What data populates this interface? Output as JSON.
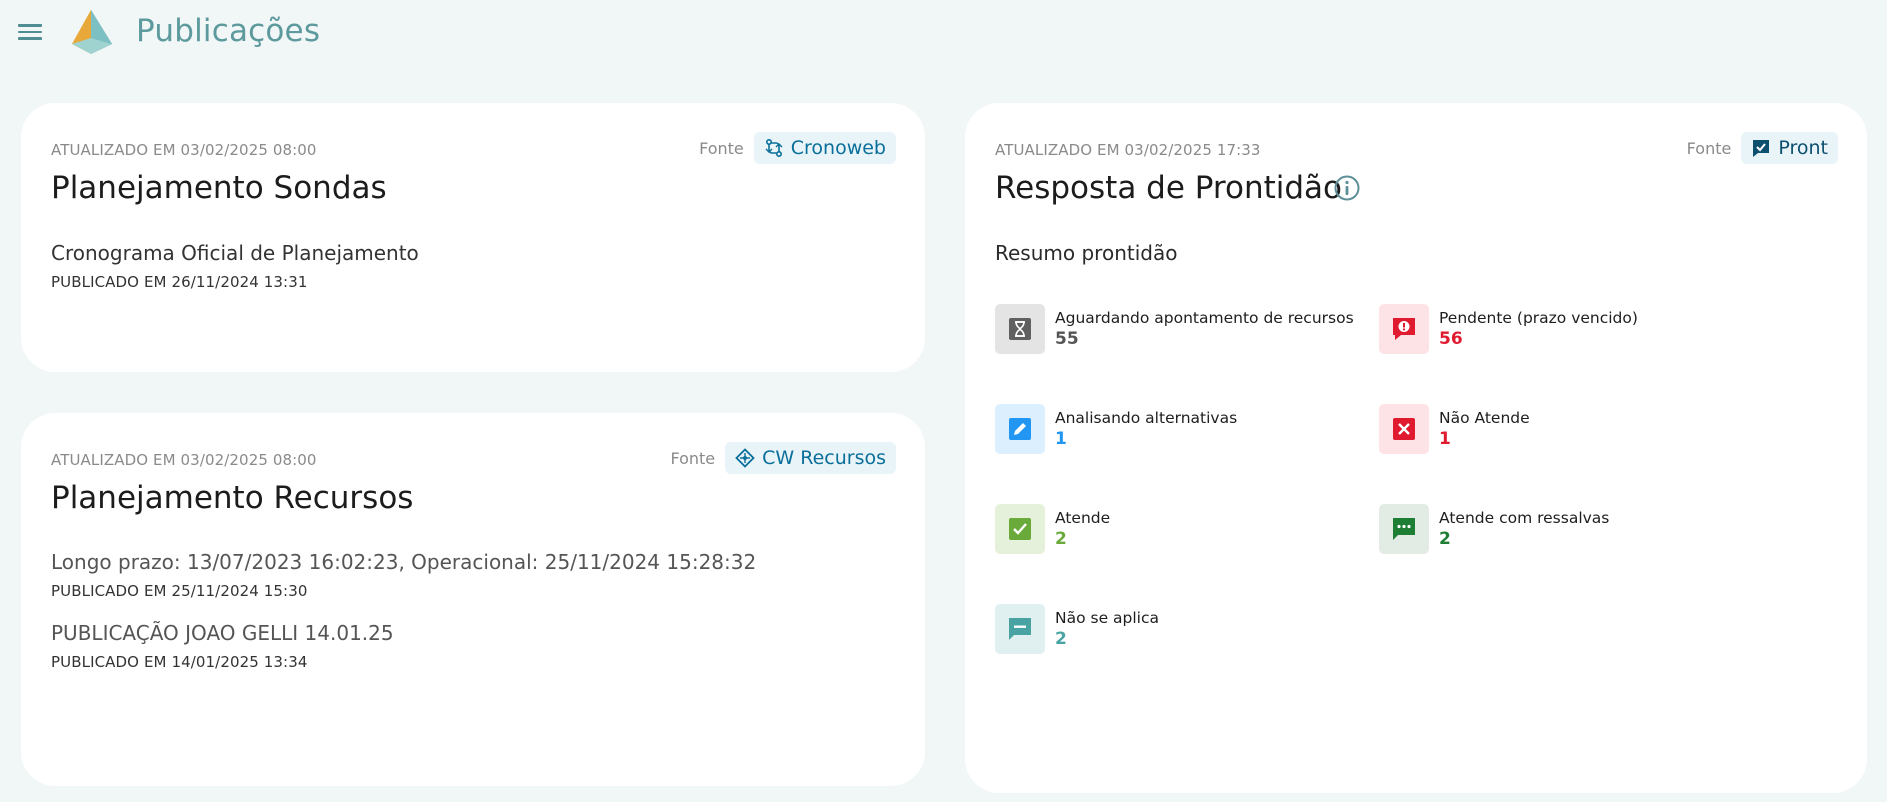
{
  "app": {
    "title": "Publicações"
  },
  "cards": {
    "sondas": {
      "updated": "ATUALIZADO EM 03/02/2025 08:00",
      "source_label": "Fonte",
      "source_name": "Cronoweb",
      "title": "Planejamento Sondas",
      "items": [
        {
          "title": "Cronograma Oficial de Planejamento",
          "published": "PUBLICADO EM 26/11/2024 13:31"
        }
      ]
    },
    "recursos": {
      "updated": "ATUALIZADO EM 03/02/2025 08:00",
      "source_label": "Fonte",
      "source_name": "CW Recursos",
      "title": "Planejamento Recursos",
      "items": [
        {
          "title": "Longo prazo: 13/07/2023 16:02:23, Operacional: 25/11/2024 15:28:32",
          "published": "PUBLICADO EM 25/11/2024 15:30"
        },
        {
          "title": "PUBLICAÇÃO JOAO GELLI 14.01.25",
          "published": "PUBLICADO EM 14/01/2025 13:34"
        }
      ]
    },
    "prontidao": {
      "updated": "ATUALIZADO EM 03/02/2025 17:33",
      "source_label": "Fonte",
      "source_name": "Pront",
      "title": "Resposta de Prontidão",
      "summary_title": "Resumo prontidão",
      "statuses": [
        {
          "label": "Aguardando apontamento de recursos",
          "value": "55",
          "icon": "hourglass-icon",
          "color": "#555555",
          "bg": "#e4e4e4"
        },
        {
          "label": "Pendente (prazo vencido)",
          "value": "56",
          "icon": "alert-icon",
          "color": "#e01b2f",
          "bg": "#fde3e5"
        },
        {
          "label": "Analisando alternativas",
          "value": "1",
          "icon": "edit-icon",
          "color": "#2196f3",
          "bg": "#dcefff"
        },
        {
          "label": "Não Atende",
          "value": "1",
          "icon": "close-box-icon",
          "color": "#e01b2f",
          "bg": "#fde3e5"
        },
        {
          "label": "Atende",
          "value": "2",
          "icon": "check-box-icon",
          "color": "#6aaa3a",
          "bg": "#e6f1dc"
        },
        {
          "label": "Atende com ressalvas",
          "value": "2",
          "icon": "comment-dots-icon",
          "color": "#1e7e34",
          "bg": "#e2ece5"
        },
        {
          "label": "Não se aplica",
          "value": "2",
          "icon": "comment-minus-icon",
          "color": "#4aa3a3",
          "bg": "#e0efef"
        }
      ]
    }
  }
}
